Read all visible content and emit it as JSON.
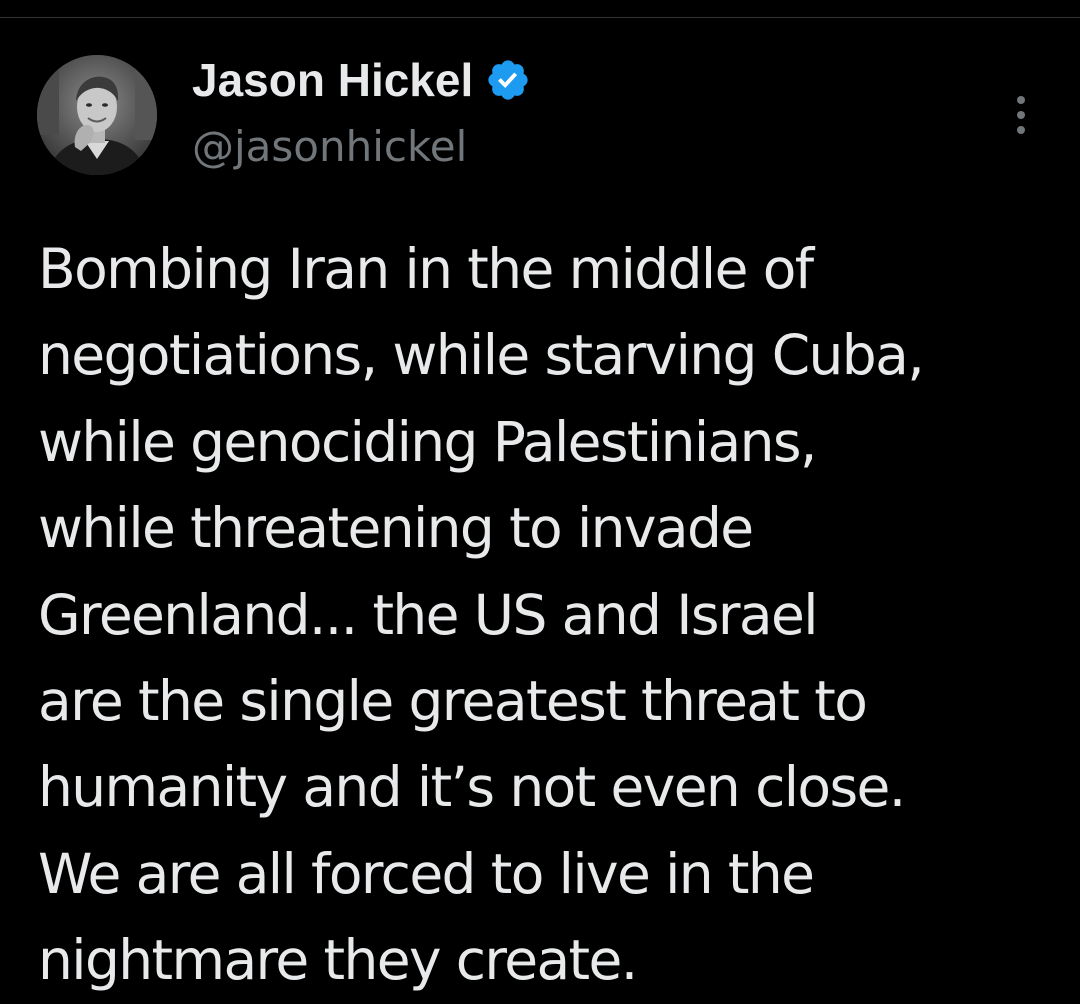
{
  "author": {
    "display_name": "Jason Hickel",
    "handle": "@jasonhickel",
    "verified": true,
    "verified_badge_color": "#1d9bf0",
    "avatar_icon": "user-avatar-photo"
  },
  "menu": {
    "icon": "more-options-icon"
  },
  "tweet": {
    "lines": [
      "Bombing Iran in the middle of",
      "negotiations, while starving Cuba,",
      "while genociding Palestinians,",
      "while threatening to invade",
      "Greenland... the US and Israel",
      "are the single greatest threat to",
      "humanity and it’s not even close.",
      "We are all forced to live in the",
      "nightmare they create."
    ]
  },
  "colors": {
    "background": "#000000",
    "text_primary": "#e7e9ea",
    "text_secondary": "#71767b",
    "divider": "#2f3336"
  }
}
